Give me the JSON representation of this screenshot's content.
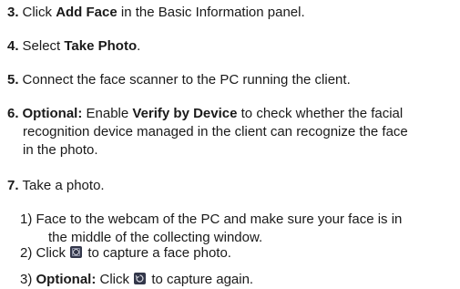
{
  "steps": [
    {
      "num": "3.",
      "pre": "Click ",
      "bold": "Add Face",
      "post": " in the Basic Information panel."
    },
    {
      "num": "4.",
      "pre": "Select ",
      "bold": "Take Photo",
      "post": "."
    },
    {
      "num": "5.",
      "text": "Connect the face scanner to the PC running the client."
    },
    {
      "num": "6.",
      "optional": "Optional:",
      "pre": " Enable ",
      "bold": "Verify by Device",
      "line1_post": " to check whether the facial",
      "line2": "recognition device managed in the client can recognize the face",
      "line3": "in the photo."
    },
    {
      "num": "7.",
      "text": "Take a photo."
    }
  ],
  "substeps": [
    {
      "num": "1)",
      "line1": "Face to the webcam of the PC and make sure your face is in",
      "line2": "the middle of the collecting window."
    },
    {
      "num": "2)",
      "pre": "Click ",
      "icon": "camera-capture-icon",
      "post": " to capture a face photo."
    },
    {
      "num": "3)",
      "optional": "Optional:",
      "pre": " Click ",
      "icon": "recapture-icon",
      "post": " to capture again."
    }
  ]
}
